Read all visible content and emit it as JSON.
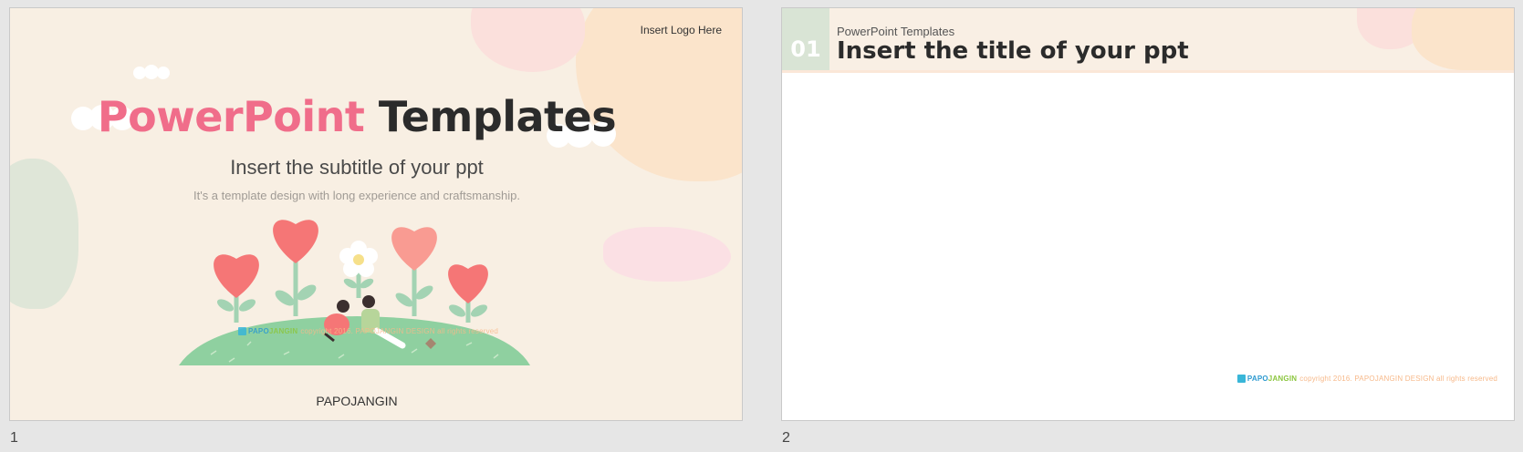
{
  "slides": [
    {
      "number": "1",
      "logo_placeholder": "Insert Logo Here",
      "title_pink": "PowerPoint",
      "title_dark": "Templates",
      "subtitle": "Insert the subtitle of your ppt",
      "description": "It's a template design with long experience and craftsmanship.",
      "author": "PAPOJANGIN",
      "brand": {
        "part1": "PAPO",
        "part2": "JANGIN",
        "copyright": "copyright 2016. PAPOJANGIN DESIGN all rights reserved"
      }
    },
    {
      "number": "2",
      "section_number": "01",
      "supertitle": "PowerPoint Templates",
      "title": "Insert the title of your ppt",
      "brand": {
        "part1": "PAPO",
        "part2": "JANGIN",
        "copyright": "copyright 2016. PAPOJANGIN DESIGN all rights reserved"
      }
    }
  ],
  "colors": {
    "slide_bg": "#f8efe3",
    "accent_pink": "#f06d8a",
    "title_dark": "#2b2b2b",
    "heart": "#f57676",
    "stem": "#a3d3b3",
    "grass": "#8fd0a0",
    "blob_green": "#d9e4d5",
    "blob_pink": "#fbe0dc",
    "blob_peach": "#fbe7cf"
  }
}
